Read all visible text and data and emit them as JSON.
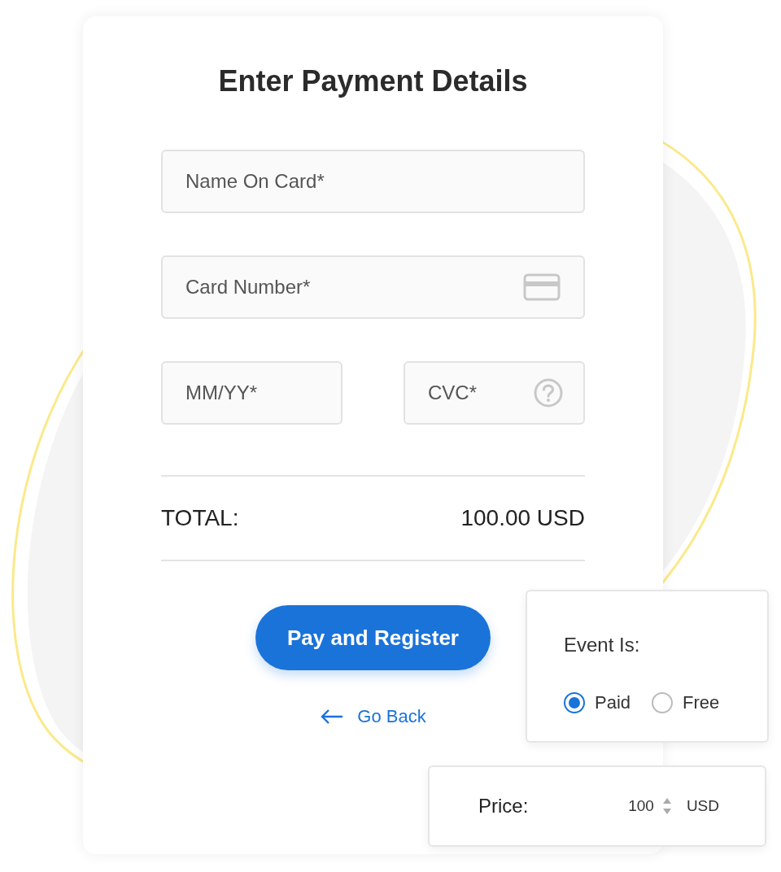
{
  "title": "Enter Payment Details",
  "fields": [
    {
      "placeholder": "Name On Card*",
      "kind": "text"
    },
    {
      "placeholder": "Card Number*",
      "kind": "card"
    },
    {
      "placeholder": "MM/YY*",
      "kind": "text"
    },
    {
      "placeholder": "CVC*",
      "kind": "help"
    }
  ],
  "total": {
    "label": "TOTAL:",
    "amount": "100.00 USD"
  },
  "submit_button": "Pay and Register",
  "back_link": "Go Back",
  "event_type": {
    "label": "Event Is:",
    "options": [
      {
        "label": "Paid",
        "selected": true
      },
      {
        "label": "Free",
        "selected": false
      }
    ]
  },
  "price": {
    "label": "Price:",
    "value": "100",
    "currency": "USD"
  }
}
